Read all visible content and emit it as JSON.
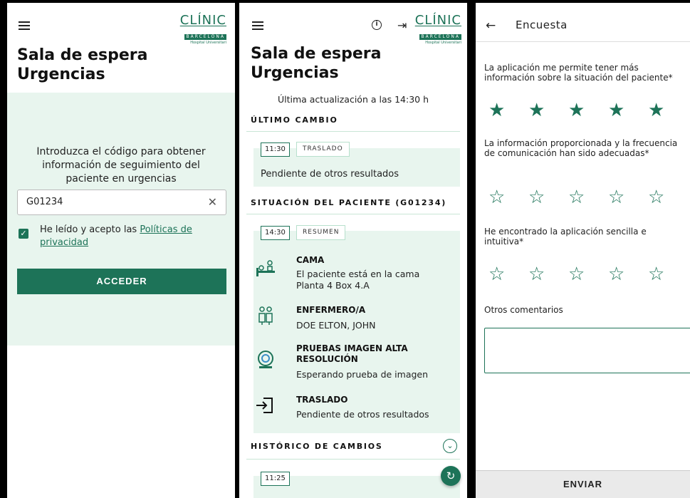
{
  "brand": {
    "name": "CLÍNIC",
    "city": "BARCELONA",
    "subtitle": "Hospital Universitari",
    "accent": "#1d7358",
    "light_green": "#e8f5ee"
  },
  "login": {
    "title": "Sala de espera Urgencias",
    "prompt": "Introduzca el código para obtener información de seguimiento del paciente en urgencias",
    "code_value": "G01234",
    "clear_icon": "close-icon",
    "consent_prefix": "He leído y acepto las ",
    "consent_link": "Políticas de privacidad",
    "submit_label": "ACCEDER"
  },
  "status": {
    "title": "Sala de espera Urgencias",
    "updated": "Última actualización a las 14:30 h",
    "last_change": {
      "heading": "ÚLTIMO CAMBIO",
      "time": "11:30",
      "type": "TRASLADO",
      "text": "Pendiente de otros resultados"
    },
    "patient": {
      "heading": "SITUACIÓN DEL PACIENTE (G01234)",
      "time": "14:30",
      "type": "RESUMEN",
      "items": [
        {
          "icon": "bed-icon",
          "title": "CAMA",
          "text": "El paciente está en la cama Planta 4 Box 4.A"
        },
        {
          "icon": "nurse-icon",
          "title": "ENFERMERO/A",
          "text": "DOE ELTON, JOHN"
        },
        {
          "icon": "scanner-icon",
          "title": "PRUEBAS IMAGEN ALTA RESOLUCIÓN",
          "text": "Esperando prueba de imagen"
        },
        {
          "icon": "transfer-icon",
          "title": "TRASLADO",
          "text": "Pendiente de otros resultados"
        }
      ]
    },
    "history": {
      "heading": "HISTÓRICO DE CAMBIOS",
      "time": "11:25"
    }
  },
  "survey": {
    "title": "Encuesta",
    "questions": [
      {
        "text": "La aplicación me permite tener más información sobre la situación del paciente*",
        "rating": 5
      },
      {
        "text": "La información proporcionada y la frecuencia de comunicación han sido adecuadas*",
        "rating": 0
      },
      {
        "text": "He encontrado la aplicación sencilla e intuitiva*",
        "rating": 0
      }
    ],
    "comments_label": "Otros comentarios",
    "comments_value": "",
    "submit_label": "ENVIAR"
  }
}
